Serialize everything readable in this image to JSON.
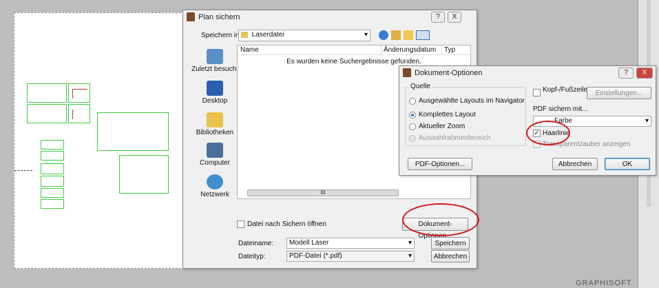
{
  "save_dialog": {
    "title": "Plan sichern",
    "help_button": "?",
    "close_button": "X",
    "save_in_label": "Speichern in:",
    "save_in_value": "Laserdatei",
    "places": [
      {
        "label": "Zuletzt besucht",
        "icon": "recent-icon",
        "color": "#5b8fc7"
      },
      {
        "label": "Desktop",
        "icon": "desktop-icon",
        "color": "#2a5fb0"
      },
      {
        "label": "Bibliotheken",
        "icon": "libraries-icon",
        "color": "#e8c24a"
      },
      {
        "label": "Computer",
        "icon": "computer-icon",
        "color": "#4a6f9a"
      },
      {
        "label": "Netzwerk",
        "icon": "network-icon",
        "color": "#3f8fd0"
      }
    ],
    "columns": [
      "Name",
      "Änderungsdatum",
      "Typ"
    ],
    "empty_message": "Es wurden keine Suchergebnisse gefunden.",
    "scroll_thumb": "III",
    "date_checkbox_label": "Datei nach Sichern öffnen",
    "document_options_button": "Dokument-Optionen...",
    "filename_label": "Dateiname:",
    "filename_value": "Modell Laser",
    "filetype_label": "Dateityp:",
    "filetype_value": "PDF-Datei (*.pdf)",
    "save_button": "Speichern",
    "cancel_button": "Abbrechen"
  },
  "options_dialog": {
    "title": "Dokument-Optionen",
    "help_button": "?",
    "close_button": "X",
    "source_group": "Quelle",
    "source_options": [
      {
        "label": "Ausgewählte Layouts im Navigator",
        "selected": false,
        "enabled": true
      },
      {
        "label": "Komplettes Layout",
        "selected": true,
        "enabled": true
      },
      {
        "label": "Aktueller Zoom",
        "selected": false,
        "enabled": true
      },
      {
        "label": "Auswahlrahmenbereich",
        "selected": false,
        "enabled": false
      }
    ],
    "header_footer_label": "Kopf-/Fußzeile",
    "settings_button": "Einstellungen...",
    "pdf_save_with_label": "PDF sichern mit...",
    "color_value": "Farbe",
    "hairline_label": "Haarlinie",
    "hairline_checked": true,
    "transparency_label": "Transparentzauber anzeigen",
    "pdf_options_button": "PDF-Optionen...",
    "cancel_button": "Abbrechen",
    "ok_button": "OK"
  },
  "branding": {
    "text": "GRAPHISOFT."
  },
  "highlight_color": "#d01818"
}
